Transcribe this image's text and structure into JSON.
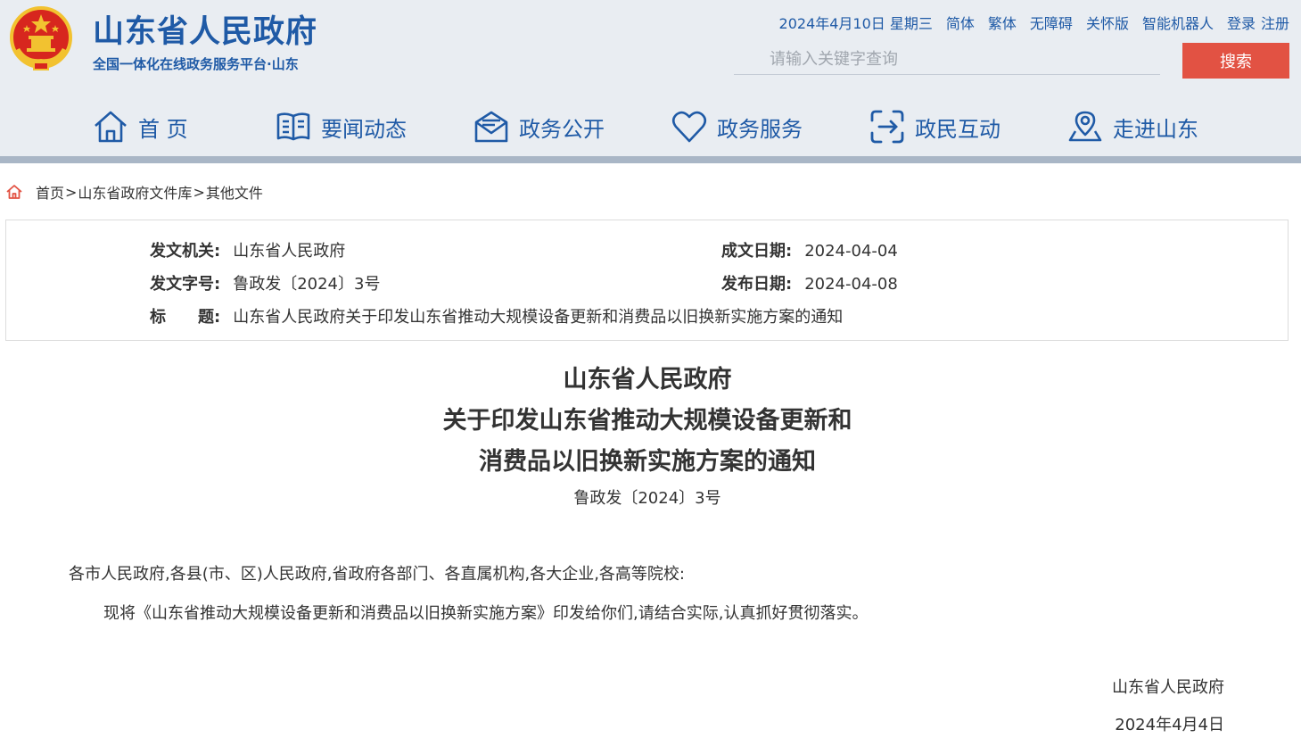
{
  "header": {
    "site_title": "山东省人民政府",
    "site_subtitle": "全国一体化在线政务服务平台·山东",
    "top_links": {
      "date": "2024年4月10日 星期三",
      "simplified": "简体",
      "traditional": "繁体",
      "accessible": "无障碍",
      "elderly": "关怀版",
      "robot": "智能机器人",
      "login": "登录",
      "register": "注册"
    },
    "search": {
      "placeholder": "请输入关键字查询",
      "button": "搜索"
    },
    "nav": [
      {
        "label": "首 页",
        "icon": "home-icon"
      },
      {
        "label": "要闻动态",
        "icon": "book-icon"
      },
      {
        "label": "政务公开",
        "icon": "mail-icon"
      },
      {
        "label": "政务服务",
        "icon": "heart-icon"
      },
      {
        "label": "政民互动",
        "icon": "interaction-icon"
      },
      {
        "label": "走进山东",
        "icon": "location-icon"
      }
    ]
  },
  "breadcrumb": {
    "items": [
      "首页",
      "山东省政府文件库",
      "其他文件"
    ],
    "separator": ">"
  },
  "info": {
    "issuer_label": "发文机关:",
    "issuer_value": "山东省人民政府",
    "created_label": "成文日期:",
    "created_value": "2024-04-04",
    "number_label": "发文字号:",
    "number_value": "鲁政发〔2024〕3号",
    "published_label": "发布日期:",
    "published_value": "2024-04-08",
    "title_label": "标　　题:",
    "title_value": "山东省人民政府关于印发山东省推动大规模设备更新和消费品以旧换新实施方案的通知"
  },
  "document": {
    "title_lines": [
      "山东省人民政府",
      "关于印发山东省推动大规模设备更新和",
      "消费品以旧换新实施方案的通知"
    ],
    "number": "鲁政发〔2024〕3号",
    "salutation": "各市人民政府,各县(市、区)人民政府,省政府各部门、各直属机构,各大企业,各高等院校:",
    "body": "现将《山东省推动大规模设备更新和消费品以旧换新实施方案》印发给你们,请结合实际,认真抓好贯彻落实。",
    "signature_org": "山东省人民政府",
    "signature_date": "2024年4月4日"
  },
  "colors": {
    "brand_blue": "#1f5aa6",
    "search_red": "#e25243",
    "header_bg": "#e9edf2",
    "emblem_red": "#d7261e",
    "emblem_gold": "#f2c230"
  }
}
